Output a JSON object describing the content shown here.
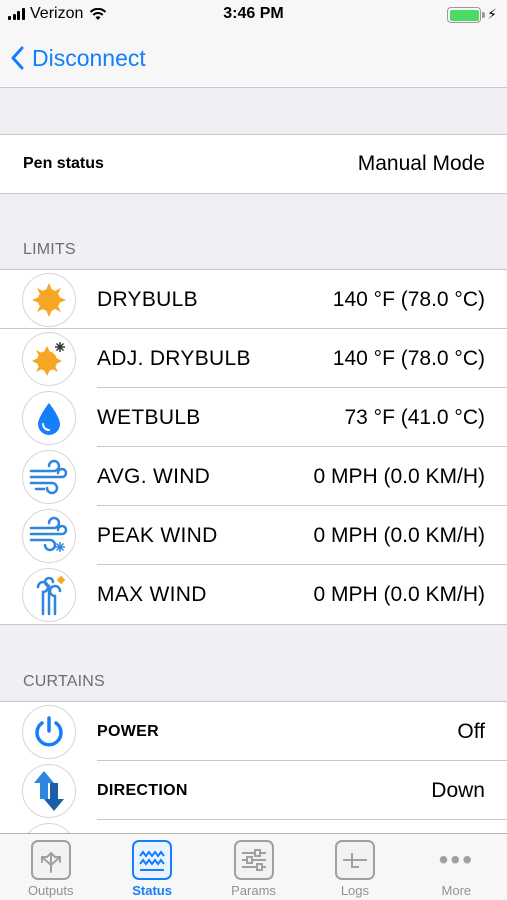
{
  "status_bar": {
    "carrier": "Verizon",
    "time": "3:46 PM"
  },
  "nav": {
    "back_label": "Disconnect"
  },
  "pen": {
    "label": "Pen status",
    "value": "Manual Mode"
  },
  "limits": {
    "header": "LIMITS",
    "items": [
      {
        "label": "DRYBULB",
        "value": "140 °F (78.0 °C)",
        "icon": "sun-icon"
      },
      {
        "label": "ADJ. DRYBULB",
        "value": "140 °F (78.0 °C)",
        "icon": "sun-adjust-icon"
      },
      {
        "label": "WETBULB",
        "value": "73 °F (41.0 °C)",
        "icon": "water-drop-icon"
      },
      {
        "label": "AVG. WIND",
        "value": "0 MPH (0.0 KM/H)",
        "icon": "wind-icon"
      },
      {
        "label": "PEAK WIND",
        "value": "0 MPH (0.0 KM/H)",
        "icon": "wind-peak-icon"
      },
      {
        "label": "MAX WIND",
        "value": "0 MPH (0.0 KM/H)",
        "icon": "wind-max-icon"
      }
    ]
  },
  "curtains": {
    "header": "CURTAINS",
    "items": [
      {
        "label": "POWER",
        "value": "Off",
        "icon": "power-icon"
      },
      {
        "label": "DIRECTION",
        "value": "Down",
        "icon": "direction-arrows-icon"
      }
    ]
  },
  "tabs": [
    {
      "label": "Outputs",
      "icon": "outputs-icon",
      "active": false
    },
    {
      "label": "Status",
      "icon": "status-wave-icon",
      "active": true
    },
    {
      "label": "Params",
      "icon": "sliders-icon",
      "active": false
    },
    {
      "label": "Logs",
      "icon": "logs-icon",
      "active": false
    },
    {
      "label": "More",
      "icon": "more-dots-icon",
      "active": false
    }
  ],
  "colors": {
    "accent": "#147efb",
    "sun": "#f5a623",
    "battery": "#4cd964"
  }
}
